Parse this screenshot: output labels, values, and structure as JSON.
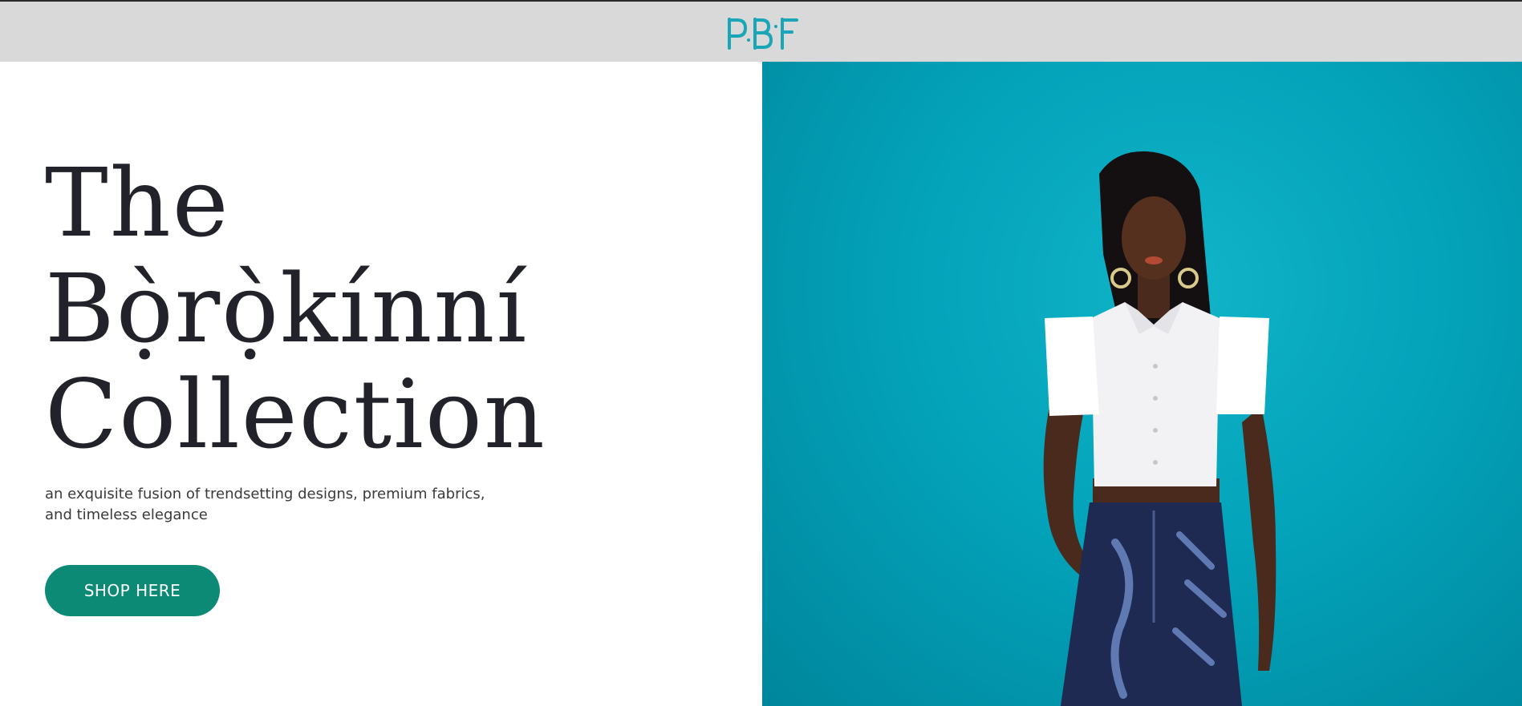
{
  "header": {
    "logo_text": "PBF",
    "logo_color": "#1aa6b7",
    "background": "#d9d9d9"
  },
  "hero": {
    "headline_lines": [
      "The",
      "Bọ̀rọ̀kínní",
      "Collection"
    ],
    "subtitle_line1": "an exquisite fusion of trendsetting designs, premium fabrics,",
    "subtitle_line2": "and timeless elegance",
    "cta_label": "SHOP HERE",
    "cta_color": "#0d8a76",
    "image_background": "#03a3ba",
    "image_subject": "model in white sleeveless shirt and navy PBF print trousers"
  }
}
